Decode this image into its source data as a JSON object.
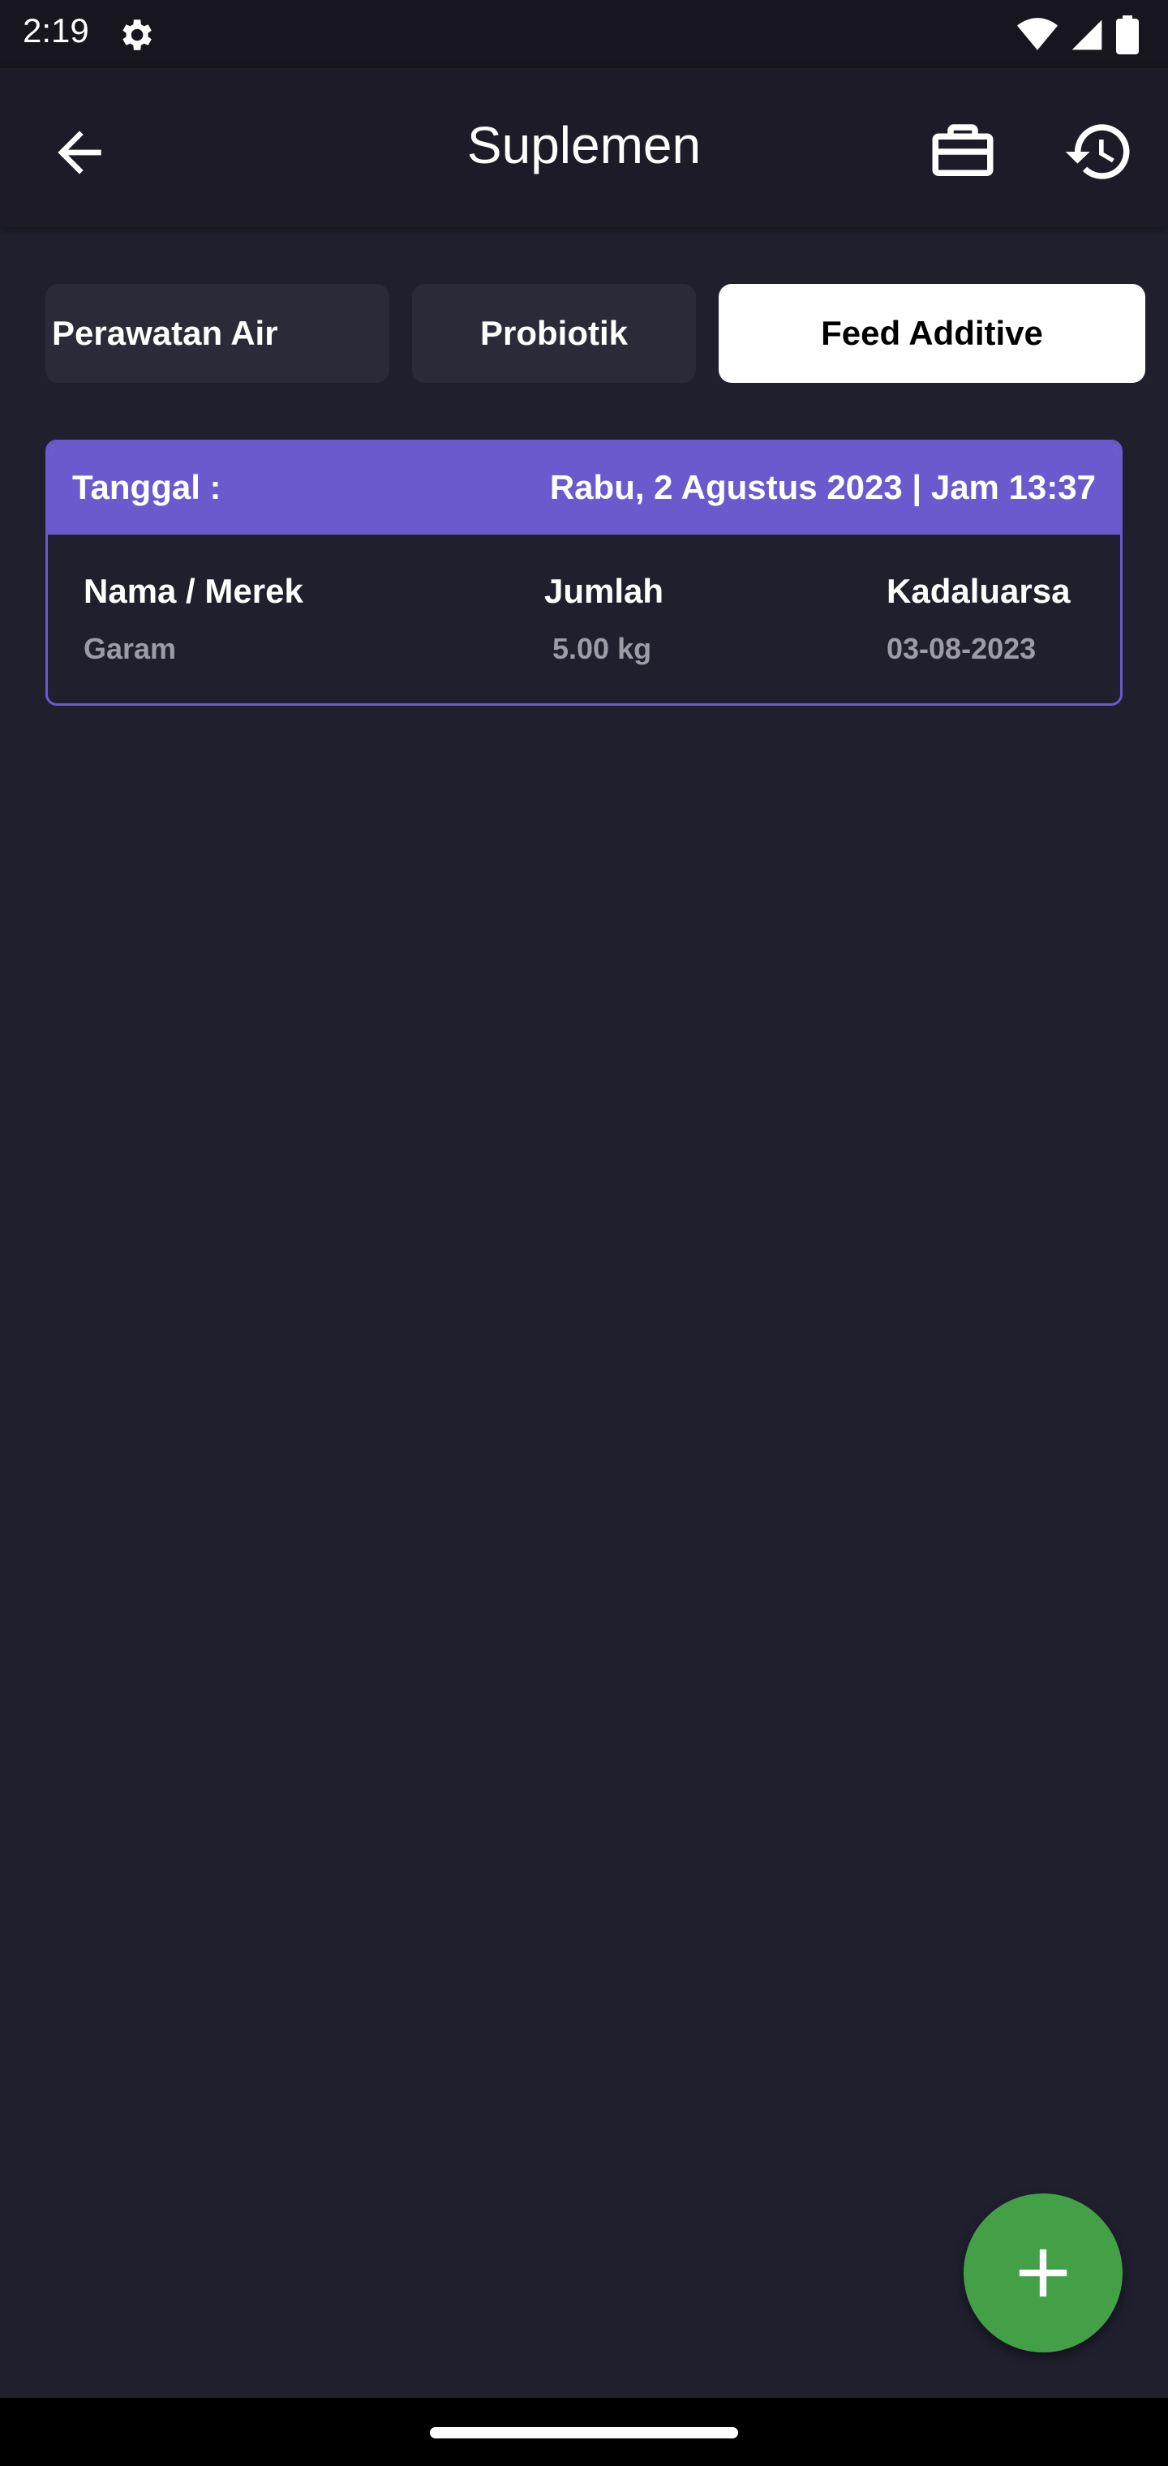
{
  "status_bar": {
    "time": "2:19",
    "icons": [
      "gear-icon",
      "wifi-icon",
      "signal-icon",
      "battery-icon"
    ]
  },
  "app_bar": {
    "title": "Suplemen",
    "back_icon": "arrow-left-icon",
    "actions": [
      "briefcase-icon",
      "history-icon"
    ]
  },
  "tabs": [
    {
      "label": "Perawatan Air",
      "active": false
    },
    {
      "label": "Probiotik",
      "active": false
    },
    {
      "label": "Feed Additive",
      "active": true
    }
  ],
  "record": {
    "date_label": "Tanggal :",
    "date_value": "Rabu, 2 Agustus 2023 | Jam 13:37",
    "columns": [
      {
        "header": "Nama / Merek",
        "value": "Garam"
      },
      {
        "header": "Jumlah",
        "value": "5.00 kg"
      },
      {
        "header": "Kadaluarsa",
        "value": "03-08-2023"
      }
    ]
  },
  "fab": {
    "icon": "plus-icon"
  },
  "colors": {
    "background": "#201f2e",
    "app_bar": "#1c1b27",
    "accent": "#6a5acd",
    "fab": "#43a047",
    "tab_inactive": "#2b2a38",
    "tab_active": "#ffffff"
  }
}
